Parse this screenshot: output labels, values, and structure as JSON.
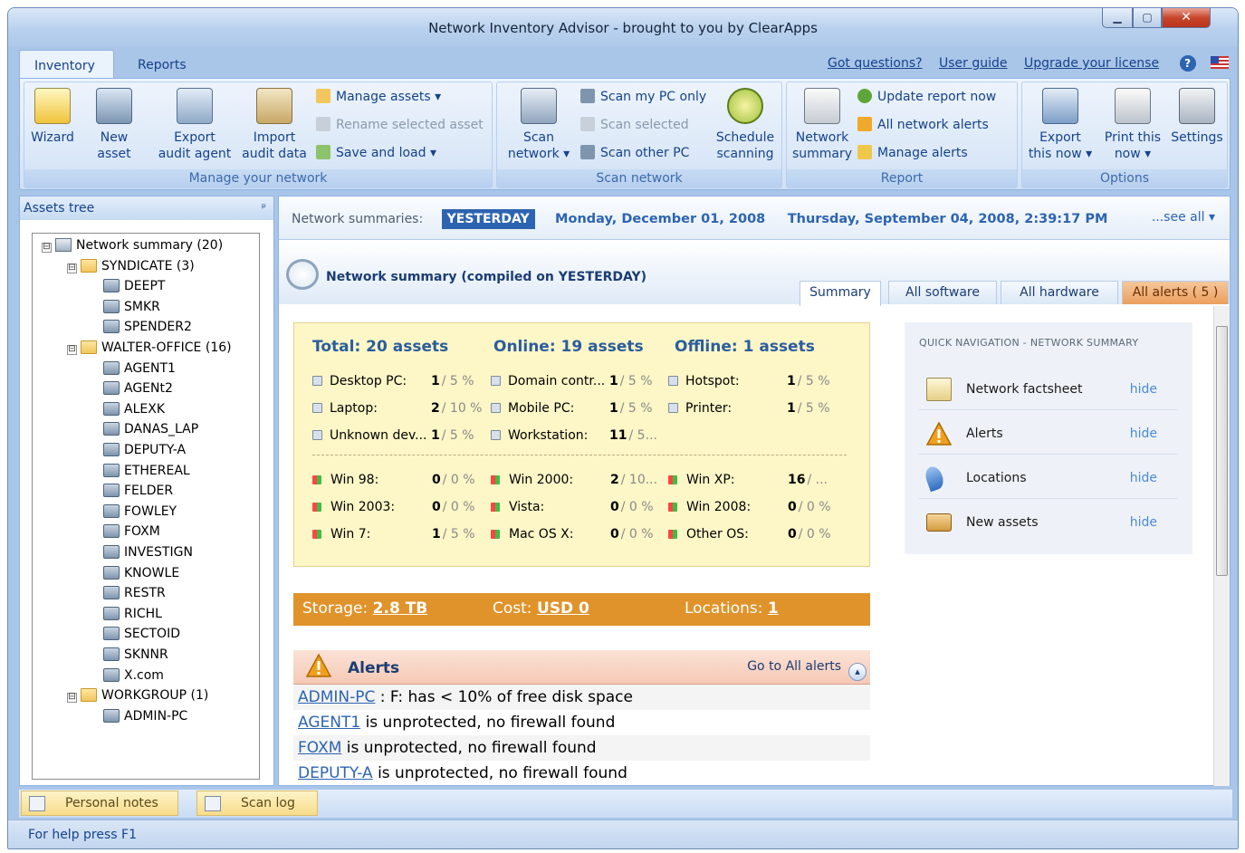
{
  "window": {
    "title": "Network Inventory Advisor - brought to you by ClearApps",
    "min": "▁",
    "max": "▢",
    "close": "✕"
  },
  "ribbon": {
    "tabs": [
      "Inventory",
      "Reports"
    ],
    "links": [
      "Got questions?",
      "User guide",
      "Upgrade your license"
    ],
    "manage": {
      "caption": "Manage your network",
      "wizard": "Wizard",
      "new_asset": [
        "New",
        "asset"
      ],
      "export_agent": [
        "Export",
        "audit agent"
      ],
      "import_data": [
        "Import",
        "audit data"
      ],
      "manage_assets": "Manage assets ▾",
      "rename": "Rename selected asset",
      "save_load": "Save and load ▾"
    },
    "scan": {
      "caption": "Scan network",
      "scan_network": [
        "Scan",
        "network ▾"
      ],
      "scan_my_pc": "Scan my PC only",
      "scan_selected": "Scan selected",
      "scan_other": "Scan other PC",
      "schedule": [
        "Schedule",
        "scanning"
      ]
    },
    "report": {
      "caption": "Report",
      "network_summary": [
        "Network",
        "summary"
      ],
      "update": "Update report now",
      "all_alerts": "All network alerts",
      "manage_alerts": "Manage alerts"
    },
    "options": {
      "caption": "Options",
      "export": [
        "Export",
        "this now ▾"
      ],
      "print": [
        "Print this",
        "now ▾"
      ],
      "settings": "Settings"
    }
  },
  "assets": {
    "header": "Assets tree",
    "pin": "ᵖ",
    "tree": [
      {
        "label": "Network summary (20)",
        "level": 0,
        "kind": "net",
        "exp": "⊟"
      },
      {
        "label": "SYNDICATE (3)",
        "level": 1,
        "kind": "folder",
        "exp": "⊟"
      },
      {
        "label": "DEEPT",
        "level": 2,
        "kind": "pc"
      },
      {
        "label": "SMKR",
        "level": 2,
        "kind": "pc"
      },
      {
        "label": "SPENDER2",
        "level": 2,
        "kind": "pc"
      },
      {
        "label": "WALTER-OFFICE (16)",
        "level": 1,
        "kind": "folder",
        "exp": "⊟"
      },
      {
        "label": "AGENT1",
        "level": 2,
        "kind": "pc"
      },
      {
        "label": "AGENt2",
        "level": 2,
        "kind": "pc"
      },
      {
        "label": "ALEXK",
        "level": 2,
        "kind": "pc"
      },
      {
        "label": "DANAS_LAP",
        "level": 2,
        "kind": "pc"
      },
      {
        "label": "DEPUTY-A",
        "level": 2,
        "kind": "pc"
      },
      {
        "label": "ETHEREAL",
        "level": 2,
        "kind": "pc"
      },
      {
        "label": "FELDER",
        "level": 2,
        "kind": "pc"
      },
      {
        "label": "FOWLEY",
        "level": 2,
        "kind": "pc"
      },
      {
        "label": "FOXM",
        "level": 2,
        "kind": "pc"
      },
      {
        "label": "INVESTIGN",
        "level": 2,
        "kind": "pc"
      },
      {
        "label": "KNOWLE",
        "level": 2,
        "kind": "pc"
      },
      {
        "label": "RESTR",
        "level": 2,
        "kind": "pc"
      },
      {
        "label": "RICHL",
        "level": 2,
        "kind": "pc"
      },
      {
        "label": "SECTOID",
        "level": 2,
        "kind": "pc"
      },
      {
        "label": "SKNNR",
        "level": 2,
        "kind": "pc"
      },
      {
        "label": "X.com",
        "level": 2,
        "kind": "pc"
      },
      {
        "label": "WORKGROUP (1)",
        "level": 1,
        "kind": "folder",
        "exp": "⊟"
      },
      {
        "label": "ADMIN-PC",
        "level": 2,
        "kind": "pc"
      }
    ]
  },
  "summary_bar": {
    "label": "Network summaries:",
    "yesterday": "YESTERDAY",
    "date1": "Monday, December 01, 2008",
    "date2": "Thursday, September 04, 2008, 2:39:17 PM",
    "see_all": "...see all ▾"
  },
  "report": {
    "title": "Network summary (compiled on YESTERDAY)",
    "tabs": {
      "summary": "Summary",
      "software": "All software",
      "hardware": "All hardware",
      "alerts": "All alerts  ( 5 )"
    }
  },
  "stats": {
    "total": "Total: 20 assets",
    "online": "Online: 19 assets",
    "offline": "Offline: 1 assets",
    "rows": [
      [
        {
          "l": "Desktop PC:",
          "n": "1",
          "p": "/ 5 %"
        },
        {
          "l": "Domain contr...",
          "n": "1",
          "p": "/ 5 %"
        },
        {
          "l": "Hotspot:",
          "n": "1",
          "p": "/ 5 %"
        }
      ],
      [
        {
          "l": "Laptop:",
          "n": "2",
          "p": "/ 10 %"
        },
        {
          "l": "Mobile PC:",
          "n": "1",
          "p": "/ 5 %"
        },
        {
          "l": "Printer:",
          "n": "1",
          "p": "/ 5 %"
        }
      ],
      [
        {
          "l": "Unknown dev...",
          "n": "1",
          "p": "/ 5 %"
        },
        {
          "l": "Workstation:",
          "n": "11",
          "p": "/ 5..."
        },
        {
          "l": "",
          "n": "",
          "p": ""
        }
      ],
      [
        {
          "l": "Win 98:",
          "n": "0",
          "p": "/ 0 %"
        },
        {
          "l": "Win 2000:",
          "n": "2",
          "p": "/ 10..."
        },
        {
          "l": "Win XP:",
          "n": "16",
          "p": "/ ..."
        }
      ],
      [
        {
          "l": "Win 2003:",
          "n": "0",
          "p": "/ 0 %"
        },
        {
          "l": "Vista:",
          "n": "0",
          "p": "/ 0 %"
        },
        {
          "l": "Win 2008:",
          "n": "0",
          "p": "/ 0 %"
        }
      ],
      [
        {
          "l": "Win 7:",
          "n": "1",
          "p": "/ 5 %"
        },
        {
          "l": "Mac OS X:",
          "n": "0",
          "p": "/ 0 %"
        },
        {
          "l": "Other OS:",
          "n": "0",
          "p": "/ 0 %"
        }
      ]
    ]
  },
  "orange": {
    "storage_l": "Storage:",
    "storage_v": "2.8 TB",
    "cost_l": "Cost:",
    "cost_v": "USD 0",
    "loc_l": "Locations:",
    "loc_v": "1"
  },
  "alerts": {
    "title": "Alerts",
    "goto": "Go to All alerts",
    "circ": "▴",
    "rows": [
      {
        "host": "ADMIN-PC",
        "text": " : F: has < 10% of free disk space"
      },
      {
        "host": "AGENT1",
        "text": " is unprotected, no firewall found"
      },
      {
        "host": "FOXM",
        "text": " is unprotected, no firewall found"
      },
      {
        "host": "DEPUTY-A",
        "text": " is unprotected, no firewall found"
      }
    ]
  },
  "quicknav": {
    "title": "QUICK NAVIGATION - NETWORK SUMMARY",
    "items": [
      {
        "label": "Network factsheet",
        "hide": "hide"
      },
      {
        "label": "Alerts",
        "hide": "hide"
      },
      {
        "label": "Locations",
        "hide": "hide"
      },
      {
        "label": "New assets",
        "hide": "hide"
      }
    ]
  },
  "bottom": {
    "notes": "Personal notes",
    "log": "Scan log"
  },
  "status": {
    "text": "For help press F1"
  }
}
